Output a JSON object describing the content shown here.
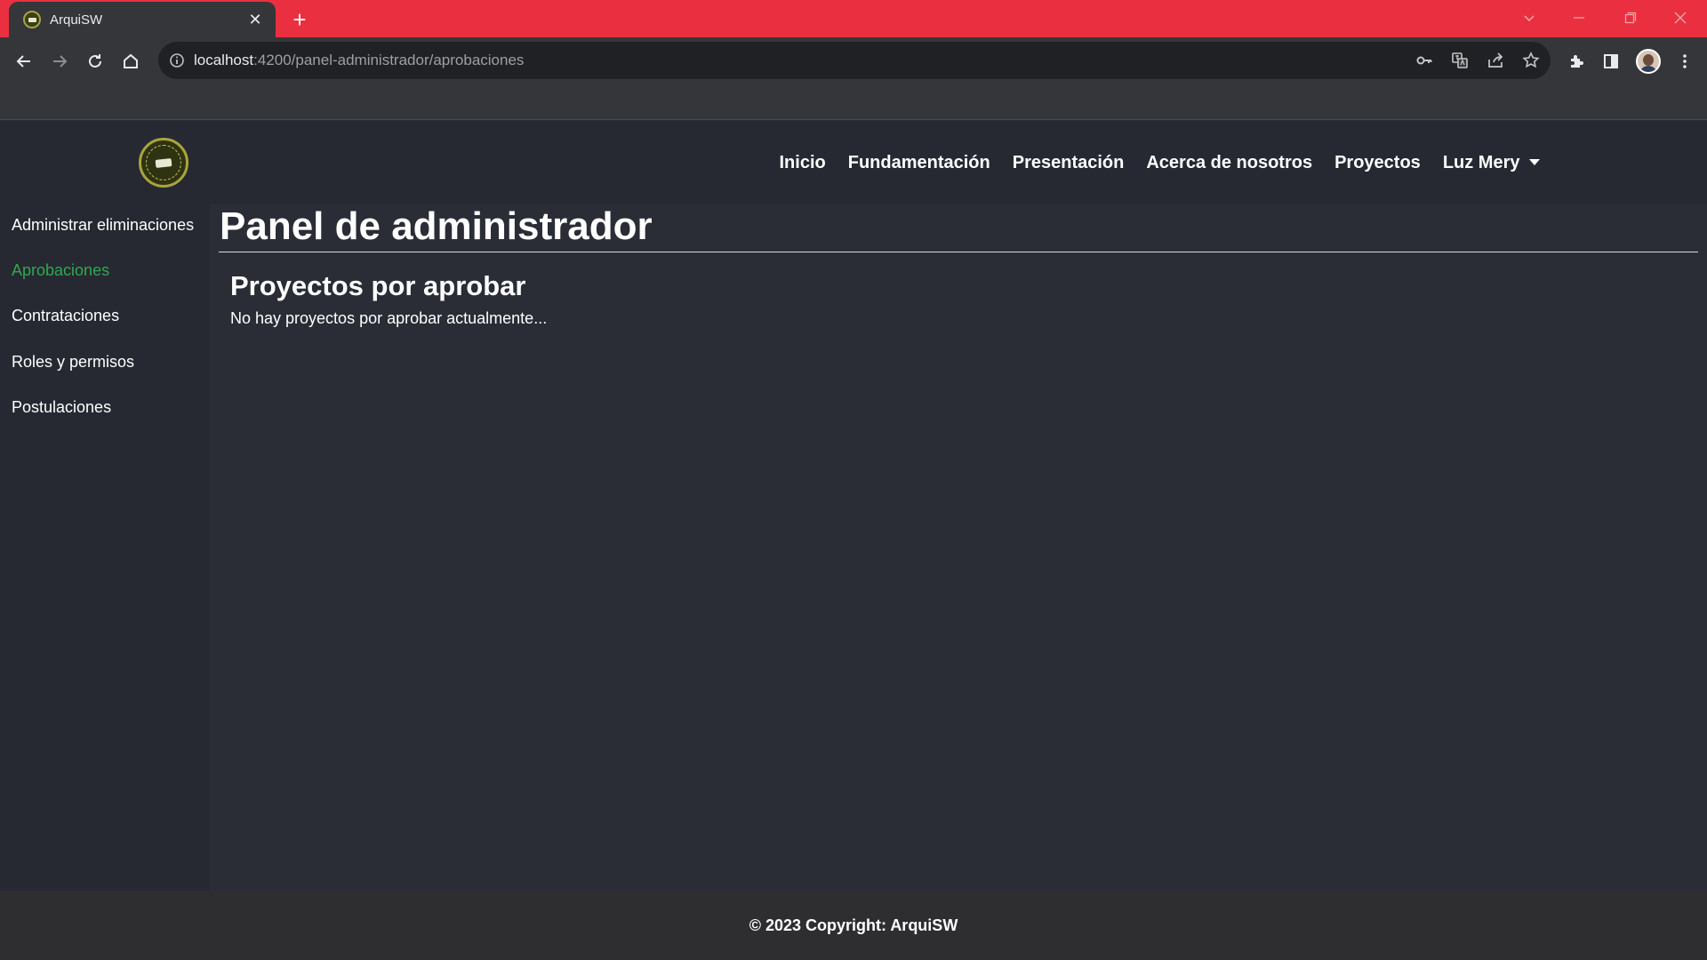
{
  "browser": {
    "tab_title": "ArquiSW",
    "url_host": "localhost",
    "url_path": ":4200/panel-administrador/aprobaciones",
    "accent_color": "#ea3040"
  },
  "navbar": {
    "links": [
      "Inicio",
      "Fundamentación",
      "Presentación",
      "Acerca de nosotros",
      "Proyectos"
    ],
    "user_menu": "Luz Mery"
  },
  "sidebar": {
    "items": [
      {
        "label": "Administrar eliminaciones",
        "active": false
      },
      {
        "label": "Aprobaciones",
        "active": true
      },
      {
        "label": "Contrataciones",
        "active": false
      },
      {
        "label": "Roles y permisos",
        "active": false
      },
      {
        "label": "Postulaciones",
        "active": false
      }
    ],
    "active_color": "#2fa84f"
  },
  "main": {
    "page_title": "Panel de administrador",
    "section_title": "Proyectos por aprobar",
    "empty_message": "No hay proyectos por aprobar actualmente..."
  },
  "footer": {
    "text": "© 2023 Copyright: ArquiSW"
  }
}
